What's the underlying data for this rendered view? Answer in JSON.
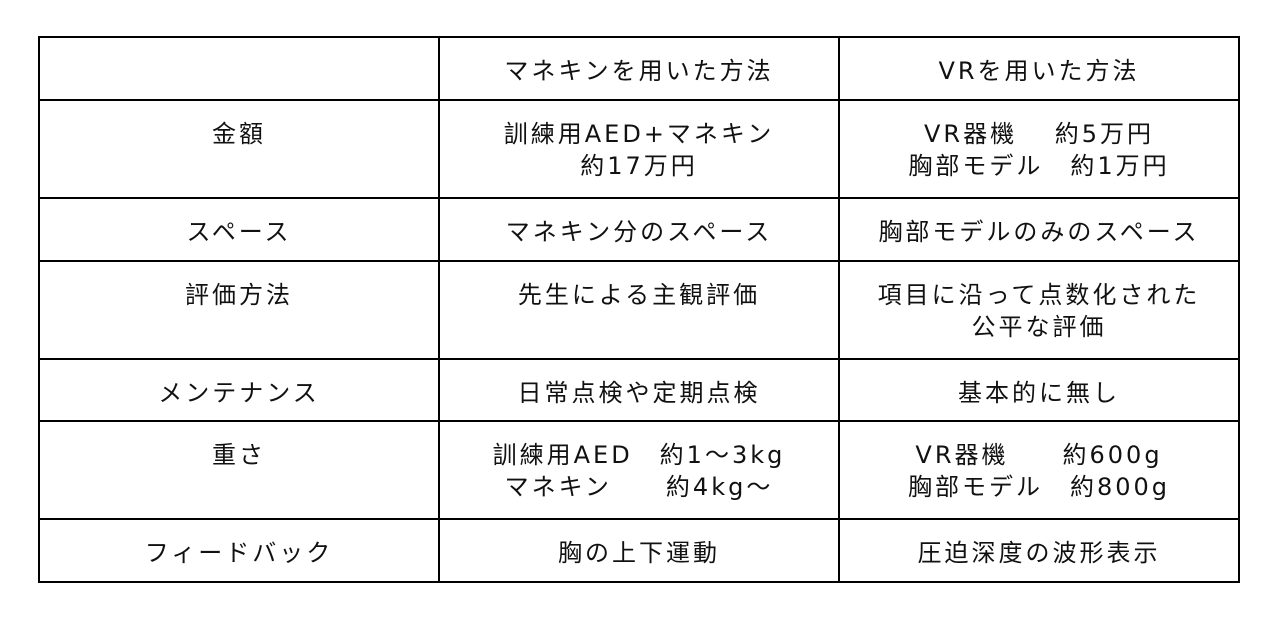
{
  "table": {
    "header": [
      "",
      "マネキンを用いた方法",
      "VRを用いた方法"
    ],
    "rows": [
      {
        "label": "金額",
        "mannequin": [
          "訓練用AED+マネキン",
          "約17万円"
        ],
        "vr": [
          "VR器機　 約5万円",
          "胸部モデル　約1万円"
        ]
      },
      {
        "label": "スペース",
        "mannequin": [
          "マネキン分のスペース"
        ],
        "vr": [
          "胸部モデルのみのスペース"
        ]
      },
      {
        "label": "評価方法",
        "mannequin": [
          "先生による主観評価"
        ],
        "vr": [
          "項目に沿って点数化された",
          "公平な評価"
        ]
      },
      {
        "label": "メンテナンス",
        "mannequin": [
          "日常点検や定期点検"
        ],
        "vr": [
          "基本的に無し"
        ]
      },
      {
        "label": "重さ",
        "mannequin": [
          "訓練用AED　約1～3kg",
          "マネキン　　約4kg～"
        ],
        "vr": [
          "VR器機　　約600g",
          "胸部モデル　約800g"
        ]
      },
      {
        "label": "フィードバック",
        "mannequin": [
          "胸の上下運動"
        ],
        "vr": [
          "圧迫深度の波形表示"
        ]
      }
    ]
  }
}
